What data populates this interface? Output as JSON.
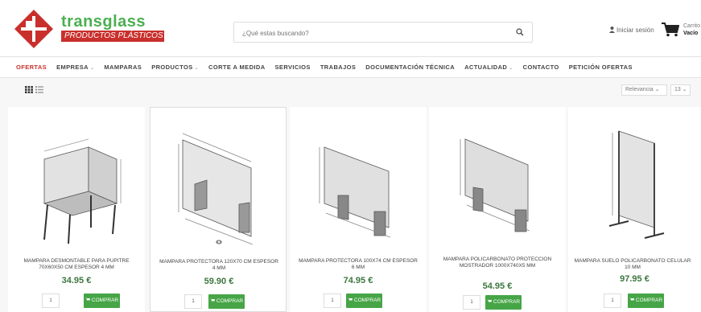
{
  "header": {
    "logo_name": "transglass",
    "logo_tagline": "PRODUCTOS PLÁSTICOS",
    "search_placeholder": "¿Qué estas buscando?",
    "login_label": "Iniciar sesión",
    "cart_label": "Carrito",
    "cart_value": "Vacío"
  },
  "nav": {
    "items": [
      {
        "label": "OFERTAS",
        "active": true
      },
      {
        "label": "EMPRESA",
        "dropdown": true
      },
      {
        "label": "MAMPARAS"
      },
      {
        "label": "PRODUCTOS",
        "dropdown": true
      },
      {
        "label": "CORTE A MEDIDA"
      },
      {
        "label": "SERVICIOS"
      },
      {
        "label": "TRABAJOS"
      },
      {
        "label": "DOCUMENTACIÓN TÉCNICA"
      },
      {
        "label": "ACTUALIDAD",
        "dropdown": true
      },
      {
        "label": "CONTACTO"
      },
      {
        "label": "PETICIÓN OFERTAS"
      }
    ]
  },
  "toolbar": {
    "sort_value": "Relevancia",
    "per_page_value": "13"
  },
  "products": [
    {
      "name": "MAMPARA DESMONTABLE PARA PUPITRE 70X60X50 CM ESPESOR 4 MM",
      "price": "34.95 €",
      "qty": "1",
      "buy_label": "COMPRAR"
    },
    {
      "name": "MAMPARA PROTECTORA 120X70 CM ESPESOR 4 MM",
      "price": "59.90 €",
      "qty": "1",
      "buy_label": "COMPRAR"
    },
    {
      "name": "MAMPARA PROTECTORA 100X74 CM ESPESOR 6 MM",
      "price": "74.95 €",
      "qty": "1",
      "buy_label": "COMPRAR"
    },
    {
      "name": "MAMPARA POLICARBONATO PROTECCION MOSTRADOR 1000X740X5 MM",
      "price": "54.95 €",
      "qty": "1",
      "buy_label": "COMPRAR"
    },
    {
      "name": "MAMPARA SUELO POLICARBONATO CELULAR 10 MM",
      "price": "97.95 €",
      "qty": "1",
      "buy_label": "COMPRAR"
    }
  ],
  "colors": {
    "brand_green": "#4caf50",
    "brand_red": "#c9302c",
    "buy_green": "#46a546"
  }
}
